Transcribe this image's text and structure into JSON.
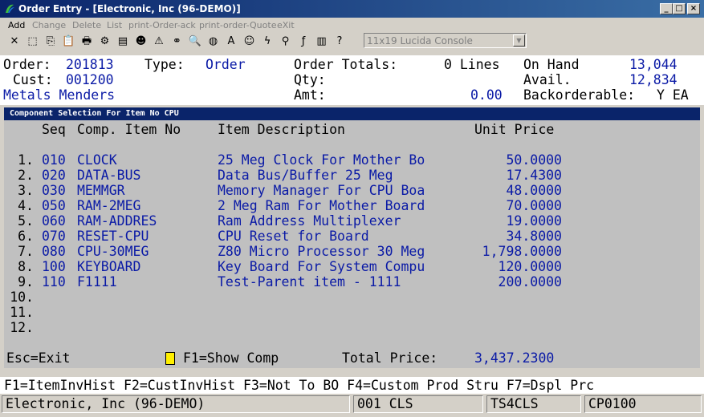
{
  "window": {
    "title": "Order Entry - [Electronic, Inc (96-DEMO)]",
    "minimize_glyph": "_",
    "maximize_glyph": "□",
    "close_glyph": "×"
  },
  "menu": {
    "items": [
      {
        "label": "Add",
        "enabled": true
      },
      {
        "label": "Change",
        "enabled": false
      },
      {
        "label": "Delete",
        "enabled": false
      },
      {
        "label": "List",
        "enabled": false
      },
      {
        "label": "print-Order-ack",
        "enabled": false
      },
      {
        "label": "print-order-Quote",
        "enabled": false
      },
      {
        "label": "eXit",
        "enabled": false
      }
    ]
  },
  "toolbar": {
    "font_combo_value": "11x19 Lucida Console",
    "icons": [
      "close-icon",
      "select-icon",
      "copy-icon",
      "paste-icon",
      "print-icon",
      "settings-icon",
      "notes-icon",
      "users-icon",
      "alert-icon",
      "binoculars-icon",
      "search-icon",
      "globe-icon",
      "font-icon",
      "person-icon",
      "lightning-icon",
      "link-icon",
      "function-icon",
      "book-icon",
      "help-icon"
    ],
    "glyphs": [
      "✕",
      "⬚",
      "⎘",
      "📋",
      "🖶",
      "⚙",
      "▤",
      "☻",
      "⚠",
      "⚭",
      "🔍",
      "◍",
      "A",
      "☺",
      "ϟ",
      "⚲",
      "ƒ",
      "▥",
      "?"
    ]
  },
  "header": {
    "order_label": "Order:",
    "order_value": "201813",
    "type_label": "Type:",
    "type_value": "Order",
    "totals_label": "Order Totals:",
    "lines_value": "0 Lines",
    "onhand_label": "On Hand",
    "onhand_value": "13,044",
    "cust_label": "Cust:",
    "cust_value": "001200",
    "qty_label": "Qty:",
    "avail_label": "Avail.",
    "avail_value": "12,834",
    "customer_name": "Metals Menders",
    "amt_label": "Amt:",
    "amt_value": "0.00",
    "backorder_label": "Backorderable:",
    "backorder_value": "Y EA"
  },
  "component_panel": {
    "title": "Component Selection For Item No CPU",
    "columns": {
      "seq": "Seq",
      "comp_item": "Comp. Item No",
      "description": "Item Description",
      "unit_price": "Unit Price"
    },
    "rows": [
      {
        "num": "1.",
        "seq": "010",
        "item": "CLOCK",
        "desc": "25 Meg Clock For Mother Bo",
        "price": "50.0000"
      },
      {
        "num": "2.",
        "seq": "020",
        "item": "DATA-BUS",
        "desc": "Data Bus/Buffer 25 Meg",
        "price": "17.4300"
      },
      {
        "num": "3.",
        "seq": "030",
        "item": "MEMMGR",
        "desc": "Memory Manager For CPU Boa",
        "price": "48.0000"
      },
      {
        "num": "4.",
        "seq": "050",
        "item": "RAM-2MEG",
        "desc": "2 Meg Ram For Mother Board",
        "price": "70.0000"
      },
      {
        "num": "5.",
        "seq": "060",
        "item": "RAM-ADDRES",
        "desc": "Ram Address Multiplexer",
        "price": "19.0000"
      },
      {
        "num": "6.",
        "seq": "070",
        "item": "RESET-CPU",
        "desc": "CPU Reset for Board",
        "price": "34.8000"
      },
      {
        "num": "7.",
        "seq": "080",
        "item": "CPU-30MEG",
        "desc": "Z80 Micro Processor 30 Meg",
        "price": "1,798.0000"
      },
      {
        "num": "8.",
        "seq": "100",
        "item": "KEYBOARD",
        "desc": "Key Board For System Compu",
        "price": "120.0000"
      },
      {
        "num": "9.",
        "seq": "110",
        "item": "F1111",
        "desc": "Test-Parent item - 1111",
        "price": "200.0000"
      },
      {
        "num": "10.",
        "seq": "",
        "item": "",
        "desc": "",
        "price": ""
      },
      {
        "num": "11.",
        "seq": "",
        "item": "",
        "desc": "",
        "price": ""
      },
      {
        "num": "12.",
        "seq": "",
        "item": "",
        "desc": "",
        "price": ""
      }
    ],
    "esc_label": "Esc=Exit",
    "f1_label": "F1=Show Comp",
    "total_label": "Total Price:",
    "total_value": "3,437.2300"
  },
  "function_keys": "F1=ItemInvHist F2=CustInvHist F3=Not To BO F4=Custom Prod Stru F7=Dspl Prc",
  "status": {
    "company": "Electronic, Inc (96-DEMO)",
    "terminal": "001 CLS",
    "station": "TS4CLS",
    "program": "CP0100"
  },
  "colors": {
    "title_bar": "#0a246a",
    "value_text": "#0a1aa6",
    "panel_bg": "#c0c0c0",
    "marker": "#ffef00"
  }
}
